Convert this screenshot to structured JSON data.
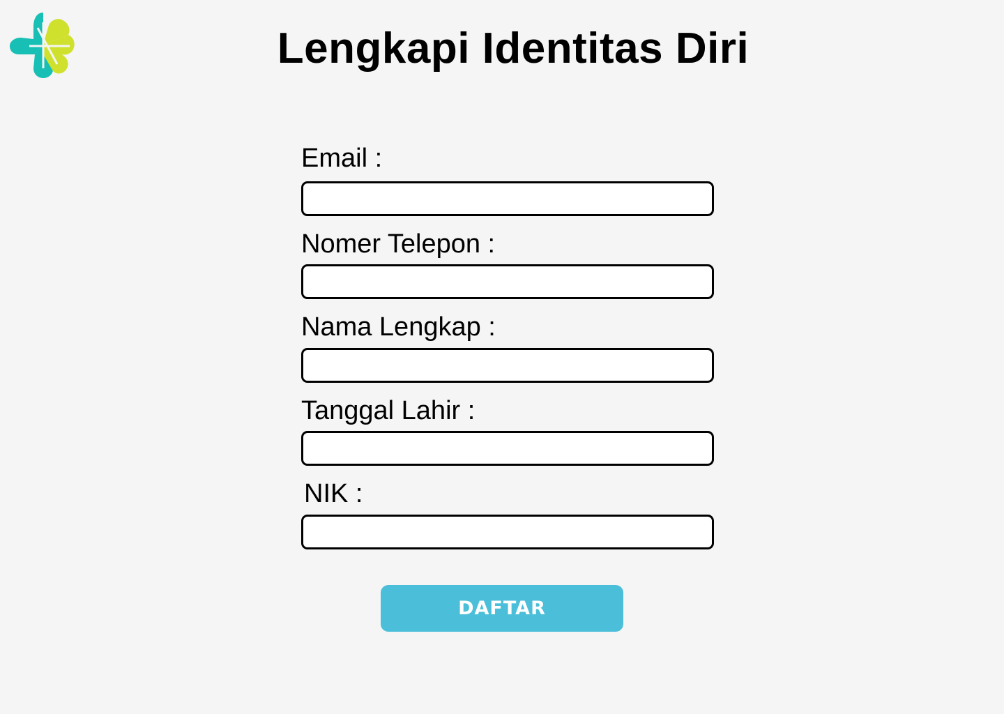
{
  "header": {
    "title": "Lengkapi Identitas Diri",
    "logo_icon": "kemenkes-logo-icon",
    "logo_colors": {
      "teal": "#17bfb5",
      "lime": "#cfe12c"
    }
  },
  "form": {
    "fields": [
      {
        "label": "Email :",
        "value": "",
        "placeholder": ""
      },
      {
        "label": "Nomer Telepon :",
        "value": "",
        "placeholder": ""
      },
      {
        "label": "Nama Lengkap :",
        "value": "",
        "placeholder": ""
      },
      {
        "label": "Tanggal Lahir :",
        "value": "",
        "placeholder": ""
      },
      {
        "label": "NIK :",
        "value": "",
        "placeholder": ""
      }
    ],
    "submit_label": "DAFTAR",
    "submit_color": "#4bbfd9"
  }
}
